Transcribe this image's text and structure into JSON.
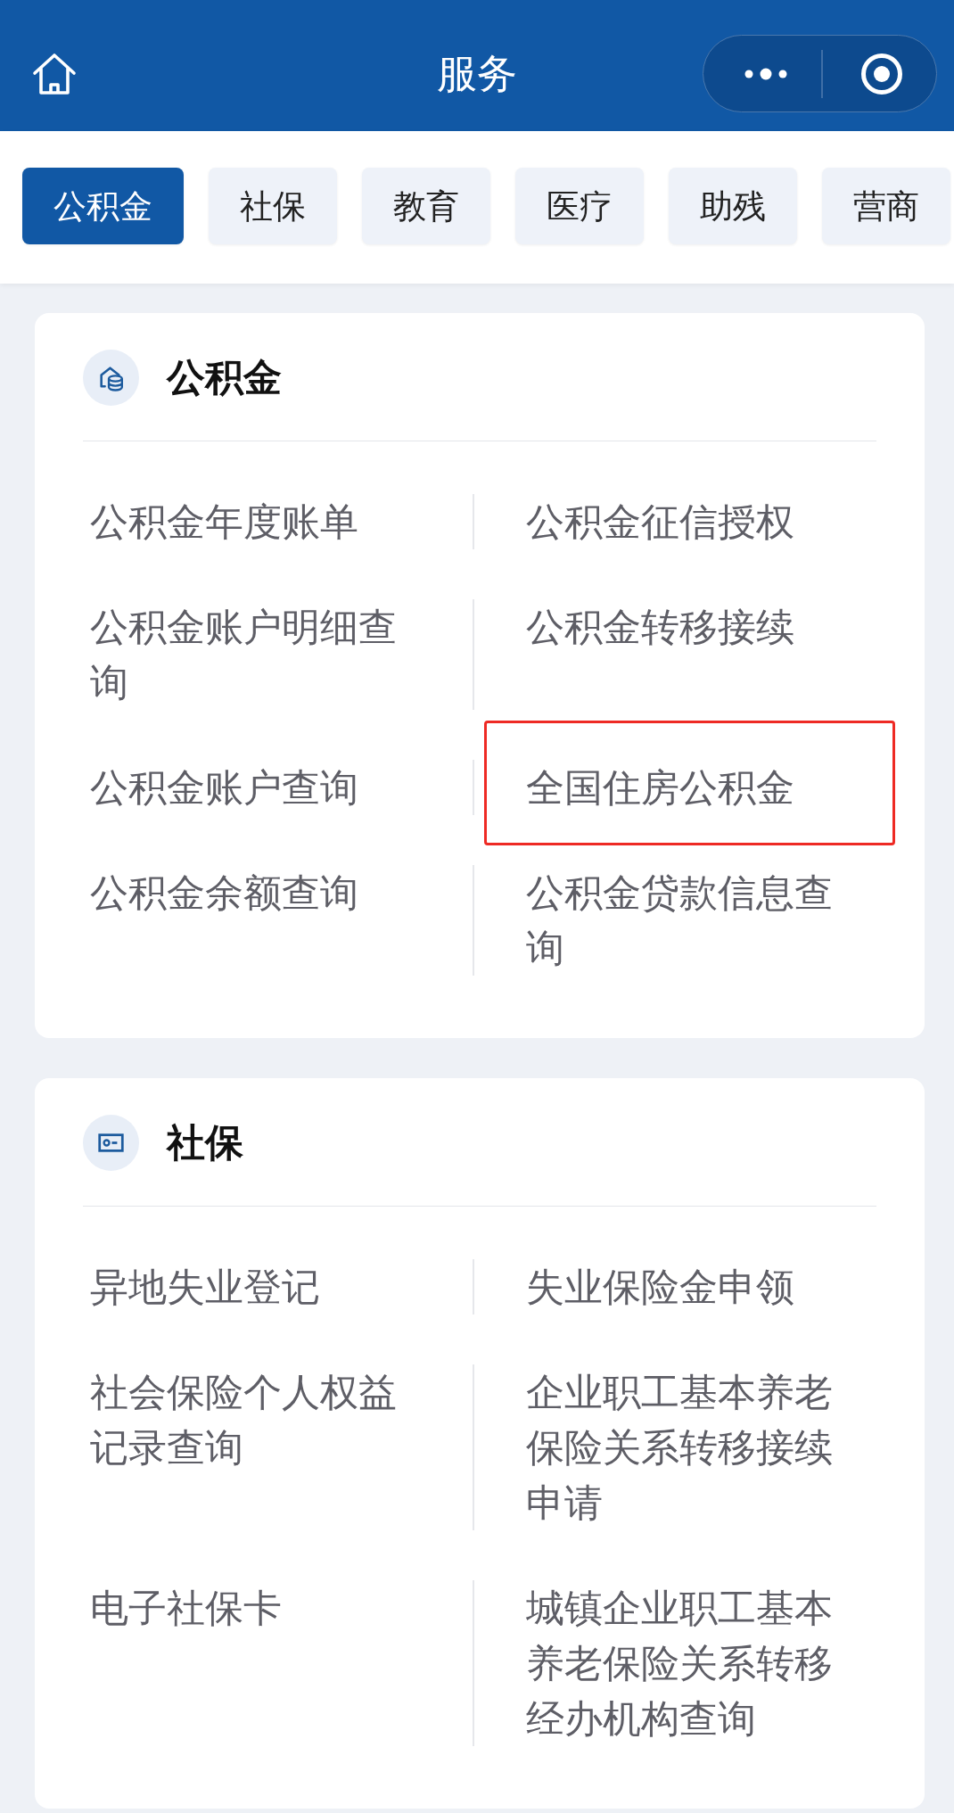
{
  "header": {
    "title": "服务"
  },
  "tabs": [
    {
      "label": "公积金",
      "selected": true
    },
    {
      "label": "社保",
      "selected": false
    },
    {
      "label": "教育",
      "selected": false
    },
    {
      "label": "医疗",
      "selected": false
    },
    {
      "label": "助残",
      "selected": false
    },
    {
      "label": "营商",
      "selected": false
    }
  ],
  "sections": [
    {
      "title": "公积金",
      "kind": "fund",
      "items": [
        {
          "label": "公积金年度账单",
          "highlighted": false
        },
        {
          "label": "公积金征信授权",
          "highlighted": false
        },
        {
          "label": "公积金账户明细查询",
          "highlighted": false
        },
        {
          "label": "公积金转移接续",
          "highlighted": false
        },
        {
          "label": "公积金账户查询",
          "highlighted": false
        },
        {
          "label": "全国住房公积金",
          "highlighted": true
        },
        {
          "label": "公积金余额查询",
          "highlighted": false
        },
        {
          "label": "公积金贷款信息查询",
          "highlighted": false
        }
      ]
    },
    {
      "title": "社保",
      "kind": "card",
      "items": [
        {
          "label": "异地失业登记",
          "highlighted": false
        },
        {
          "label": "失业保险金申领",
          "highlighted": false
        },
        {
          "label": "社会保险个人权益记录查询",
          "highlighted": false
        },
        {
          "label": "企业职工基本养老保险关系转移接续申请",
          "highlighted": false
        },
        {
          "label": "电子社保卡",
          "highlighted": false
        },
        {
          "label": "城镇企业职工基本养老保险关系转移经办机构查询",
          "highlighted": false
        }
      ]
    }
  ]
}
